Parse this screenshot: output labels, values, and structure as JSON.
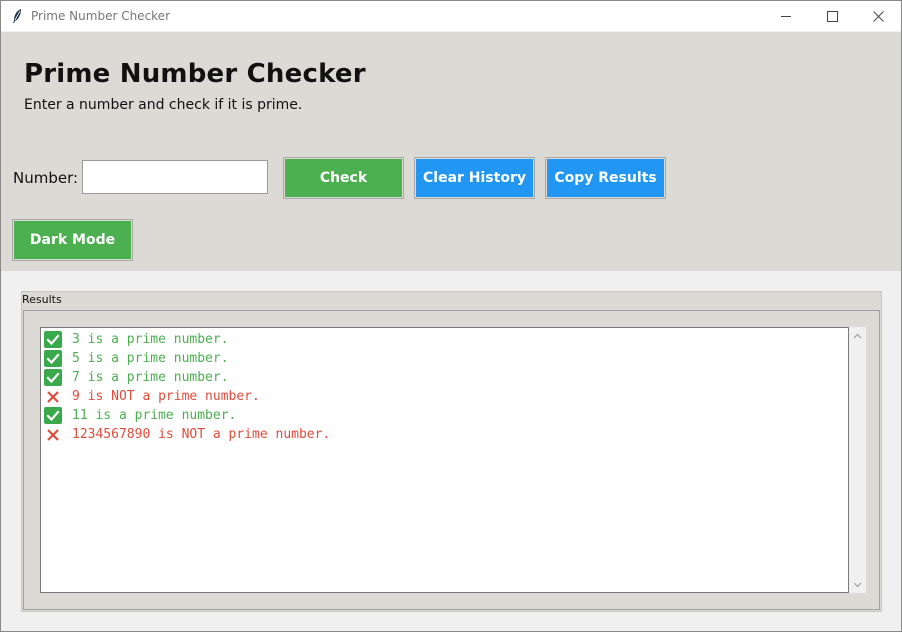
{
  "window": {
    "title": "Prime Number Checker",
    "controls": {
      "minimize": "—",
      "maximize": "☐",
      "close": "✕"
    }
  },
  "header": {
    "title": "Prime Number Checker",
    "subtitle": "Enter a number and check if it is prime."
  },
  "form": {
    "number_label": "Number:",
    "number_value": "",
    "number_placeholder": ""
  },
  "buttons": {
    "check": "Check",
    "clear_history": "Clear History",
    "copy_results": "Copy Results",
    "dark_mode": "Dark Mode"
  },
  "results": {
    "label": "Results",
    "items": [
      {
        "icon": "check-mark-icon",
        "text": "3 is a prime number.",
        "prime": true
      },
      {
        "icon": "check-mark-icon",
        "text": "5 is a prime number.",
        "prime": true
      },
      {
        "icon": "check-mark-icon",
        "text": "7 is a prime number.",
        "prime": true
      },
      {
        "icon": "cross-mark-icon",
        "text": "9 is NOT a prime number.",
        "prime": false
      },
      {
        "icon": "check-mark-icon",
        "text": "11 is a prime number.",
        "prime": true
      },
      {
        "icon": "cross-mark-icon",
        "text": "1234567890 is NOT a prime number.",
        "prime": false
      }
    ]
  },
  "colors": {
    "panel_bg": "#dcdad5",
    "green": "#4caf50",
    "blue": "#2196f3",
    "prime_text": "#4caf50",
    "not_prime_text": "#e04c3c"
  }
}
